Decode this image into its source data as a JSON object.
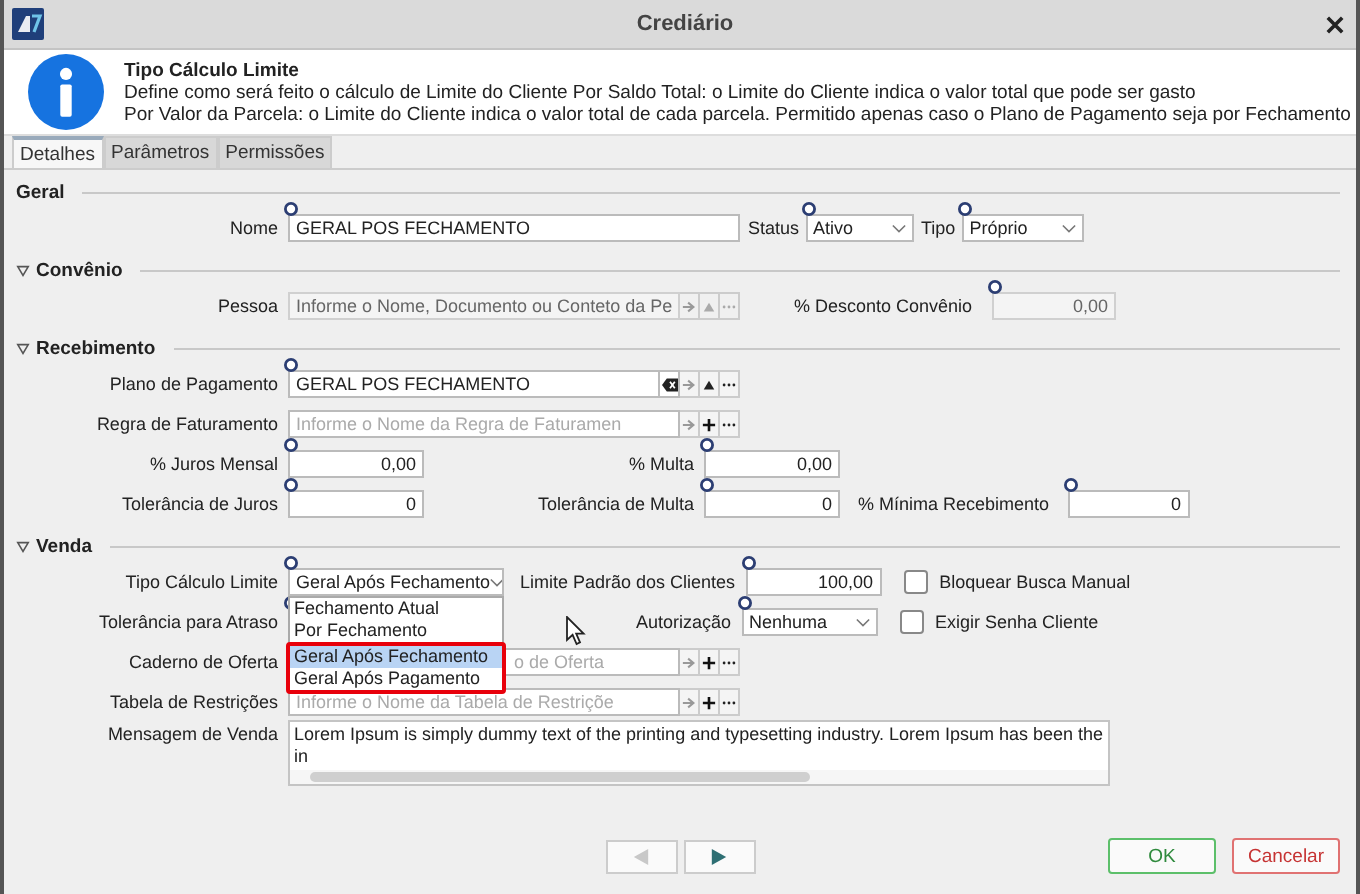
{
  "window": {
    "title": "Crediário"
  },
  "info": {
    "title": "Tipo Cálculo Limite",
    "lines": [
      "Define como será feito o cálculo de Limite do Cliente Por Saldo Total: o Limite do Cliente indica o valor total que pode ser gasto",
      "Por Valor da Parcela: o Limite do Cliente indica o valor total de cada parcela. Permitido apenas caso o Plano de Pagamento seja por Fechamento"
    ]
  },
  "tabs": [
    {
      "label": "Detalhes",
      "selected": true
    },
    {
      "label": "Parâmetros",
      "selected": false
    },
    {
      "label": "Permissões",
      "selected": false
    }
  ],
  "geral": {
    "title": "Geral",
    "nome": {
      "label": "Nome",
      "value": "GERAL POS FECHAMENTO",
      "required": true
    },
    "status": {
      "label": "Status",
      "value": "Ativo",
      "required": true
    },
    "tipo": {
      "label": "Tipo",
      "value": "Próprio",
      "required": true
    }
  },
  "convenio": {
    "title": "Convênio",
    "expanded": true,
    "pessoa": {
      "label": "Pessoa",
      "placeholder": "Informe o Nome, Documento ou Conteto da Pe",
      "disabled": true,
      "actions": [
        {
          "kind": "go"
        },
        {
          "kind": "up"
        },
        {
          "kind": "more"
        }
      ]
    },
    "desconto": {
      "label": "% Desconto Convênio",
      "value": "0,00",
      "required": true,
      "disabled": true
    }
  },
  "recebimento": {
    "title": "Recebimento",
    "expanded": true,
    "plano": {
      "label": "Plano de Pagamento",
      "value": "GERAL POS FECHAMENTO",
      "required": true,
      "disabled": false,
      "actions": [
        {
          "kind": "clear"
        },
        {
          "kind": "go"
        },
        {
          "kind": "up"
        },
        {
          "kind": "more"
        }
      ]
    },
    "regra": {
      "label": "Regra de Faturamento",
      "placeholder": "Informe o Nome da Regra de Faturamen",
      "disabled": false,
      "actions": [
        {
          "kind": "go"
        },
        {
          "kind": "add"
        },
        {
          "kind": "more"
        }
      ]
    },
    "juros": {
      "label": "% Juros Mensal",
      "value": "0,00",
      "required": true
    },
    "multa": {
      "label": "% Multa",
      "value": "0,00",
      "required": true
    },
    "tol_juros": {
      "label": "Tolerância de Juros",
      "value": "0",
      "required": true
    },
    "tol_multa": {
      "label": "Tolerância de Multa",
      "value": "0",
      "required": true
    },
    "minima": {
      "label": "% Mínima Recebimento",
      "value": "0",
      "required": true
    }
  },
  "venda": {
    "title": "Venda",
    "expanded": true,
    "tipo_calculo": {
      "label": "Tipo Cálculo Limite",
      "value": "Geral Após Fechamento",
      "required": true,
      "expanded": true,
      "options": [
        {
          "label": "Fechamento Atual",
          "selected": false,
          "marked": false
        },
        {
          "label": "Por Fechamento",
          "selected": false,
          "marked": false
        },
        {
          "label": "Geral Após Fechamento",
          "selected": true,
          "marked": true
        },
        {
          "label": "Geral Após Pagamento",
          "selected": false,
          "marked": true
        }
      ]
    },
    "limite": {
      "label": "Limite Padrão dos Clientes",
      "value": "100,00",
      "required": true
    },
    "bloquear": {
      "label": "Bloquear Busca Manual",
      "checked": false
    },
    "tol_atraso": {
      "label": "Tolerância para Atraso",
      "required": true
    },
    "autorizacao": {
      "label": "Autorização",
      "value": "Nenhuma",
      "required": true
    },
    "exigir": {
      "label": "Exigir Senha Cliente",
      "checked": false
    },
    "caderno": {
      "label": "Caderno de Oferta",
      "placeholder": "o de Oferta",
      "disabled": false,
      "actions": [
        {
          "kind": "go"
        },
        {
          "kind": "add"
        },
        {
          "kind": "more"
        }
      ]
    },
    "tabela": {
      "label": "Tabela de Restrições",
      "placeholder": "Informe o Nome da Tabela de Restriçõe",
      "disabled": false,
      "actions": [
        {
          "kind": "go"
        },
        {
          "kind": "add"
        },
        {
          "kind": "more"
        }
      ]
    },
    "mensagem": {
      "label": "Mensagem de Venda",
      "value": "Lorem Ipsum is simply dummy text of the printing and typesetting industry. Lorem Ipsum has been the in"
    }
  },
  "navigation": {
    "previous_disabled": true,
    "next_disabled": false
  },
  "buttons": [
    {
      "label": "OK",
      "kind": "confirm"
    },
    {
      "label": "Cancelar",
      "kind": "cancel"
    }
  ]
}
